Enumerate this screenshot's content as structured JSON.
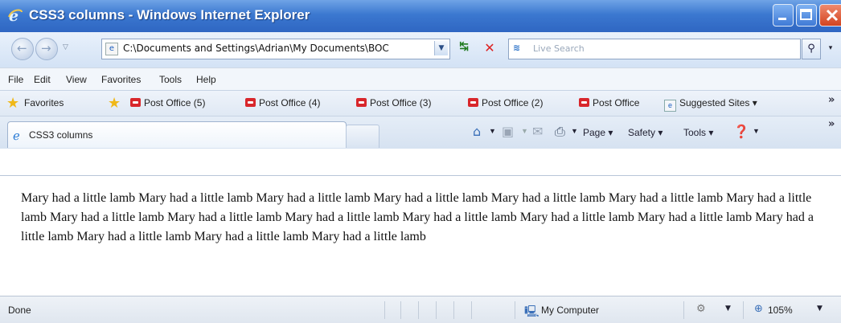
{
  "window": {
    "title": "CSS3 columns - Windows Internet Explorer"
  },
  "address": {
    "url": "C:\\Documents and Settings\\Adrian\\My Documents\\BOC",
    "search_placeholder": "Live Search"
  },
  "menu": [
    "File",
    "Edit",
    "View",
    "Favorites",
    "Tools",
    "Help"
  ],
  "favorites": {
    "label": "Favorites",
    "items": [
      "Post Office (5)",
      "Post Office (4)",
      "Post Office (3)",
      "Post Office (2)",
      "Post Office",
      "Suggested Sites ▾"
    ]
  },
  "tabs": {
    "active_label": "CSS3 columns"
  },
  "commands": {
    "page": "Page ▾",
    "safety": "Safety ▾",
    "tools": "Tools ▾"
  },
  "content": {
    "text": "Mary had a little lamb Mary had a little lamb Mary had a little lamb Mary had a little lamb Mary had a little lamb Mary had a little lamb Mary had a little lamb Mary had a little lamb Mary had a little lamb Mary had a little lamb Mary had a little lamb Mary had a little lamb Mary had a little lamb Mary had a little lamb Mary had a little lamb Mary had a little lamb Mary had a little lamb"
  },
  "status": {
    "text": "Done",
    "zone": "My Computer",
    "zoom": "105%"
  },
  "colors": {
    "titlebar": "#3b78d0",
    "close_button": "#d2441f",
    "post_office_icon": "#d8262b"
  },
  "icons": [
    "ie-logo-icon",
    "back-arrow-icon",
    "forward-arrow-icon",
    "page-icon",
    "refresh-icon",
    "stop-icon",
    "live-search-icon",
    "search-icon",
    "favorites-star-icon",
    "add-favorites-icon",
    "post-office-icon",
    "suggested-sites-icon",
    "home-icon",
    "feeds-icon",
    "mail-icon",
    "print-icon",
    "help-icon",
    "computer-icon",
    "protected-mode-icon",
    "zoom-icon"
  ]
}
